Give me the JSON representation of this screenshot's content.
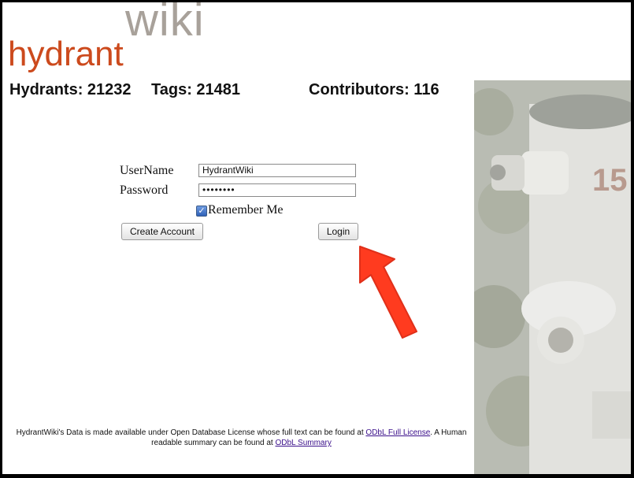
{
  "logo": {
    "wiki": "wiki",
    "hydrant": "hydrant"
  },
  "stats": {
    "hydrants": "Hydrants: 21232",
    "tags": "Tags: 21481",
    "contributors": "Contributors: 116"
  },
  "login_form": {
    "username_label": "UserName",
    "username_value": "HydrantWiki",
    "password_label": "Password",
    "password_value": "••••••••",
    "remember_label": "Remember Me",
    "remember_checked": true,
    "create_account_label": "Create Account",
    "login_label": "Login"
  },
  "footer": {
    "text_1": "HydrantWiki's Data is made available under Open Database License whose full text can be found at ",
    "link_full": "ODbL Full License",
    "text_2": ". A Human readable summary can be found at ",
    "link_summary": "ODbL Summary"
  },
  "colors": {
    "logo_wiki": "#a8a19a",
    "logo_hydrant": "#cc4a1d",
    "arrow": "#ff3b1f"
  },
  "icons": {
    "annotation_arrow": "red-arrow-icon",
    "checkbox": "checkmark-icon"
  }
}
